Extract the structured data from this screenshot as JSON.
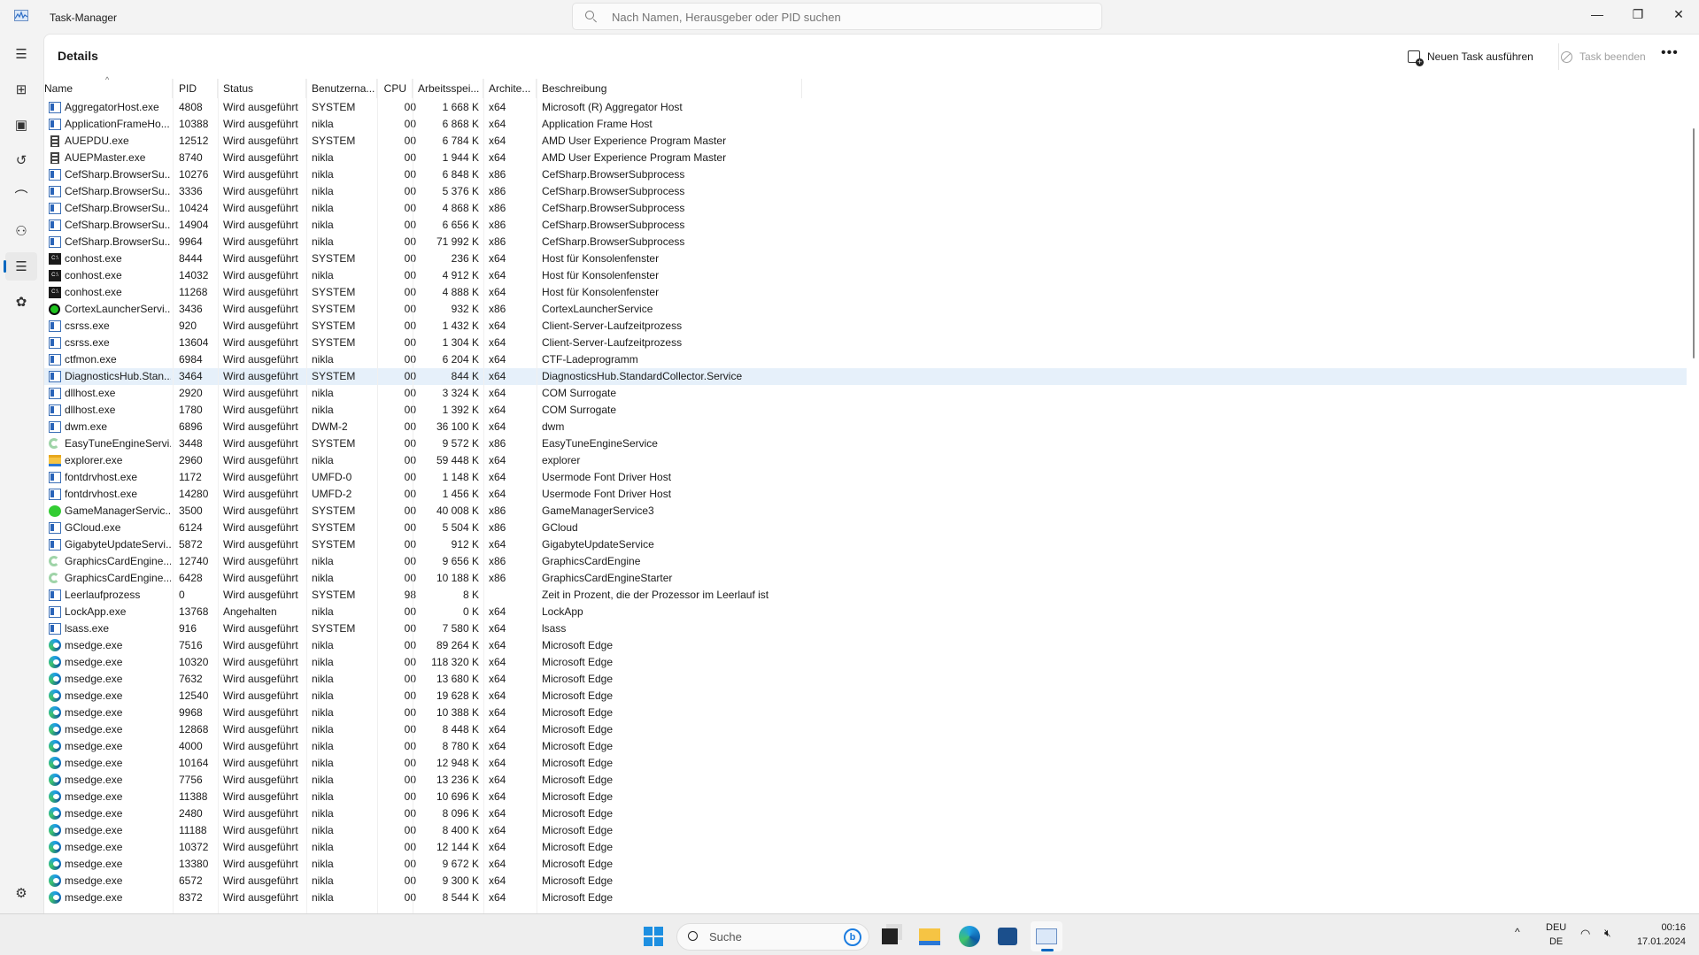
{
  "window": {
    "title": "Task-Manager",
    "search_placeholder": "Nach Namen, Herausgeber oder PID suchen"
  },
  "page": {
    "title": "Details",
    "new_task": "Neuen Task ausführen",
    "end_task": "Task beenden",
    "more": "•••"
  },
  "sidebar": [
    "menu-icon",
    "processes-icon",
    "performance-icon",
    "app-history-icon",
    "startup-apps-icon",
    "users-icon",
    "details-icon",
    "services-icon",
    "settings-icon"
  ],
  "columns": [
    "Name",
    "PID",
    "Status",
    "Benutzerna...",
    "CPU",
    "Arbeitsspei...",
    "Archite...",
    "Beschreibung"
  ],
  "selected_row": 16,
  "rows": [
    [
      "window",
      "AggregatorHost.exe",
      "4808",
      "Wird ausgeführt",
      "SYSTEM",
      "00",
      "1 668 K",
      "x64",
      "Microsoft (R) Aggregator Host"
    ],
    [
      "window",
      "ApplicationFrameHo...",
      "10388",
      "Wird ausgeführt",
      "nikla",
      "00",
      "6 868 K",
      "x64",
      "Application Frame Host"
    ],
    [
      "amd",
      "AUEPDU.exe",
      "12512",
      "Wird ausgeführt",
      "SYSTEM",
      "00",
      "6 784 K",
      "x64",
      "AMD User Experience Program Master"
    ],
    [
      "amd",
      "AUEPMaster.exe",
      "8740",
      "Wird ausgeführt",
      "nikla",
      "00",
      "1 944 K",
      "x64",
      "AMD User Experience Program Master"
    ],
    [
      "window",
      "CefSharp.BrowserSu...",
      "10276",
      "Wird ausgeführt",
      "nikla",
      "00",
      "6 848 K",
      "x86",
      "CefSharp.BrowserSubprocess"
    ],
    [
      "window",
      "CefSharp.BrowserSu...",
      "3336",
      "Wird ausgeführt",
      "nikla",
      "00",
      "5 376 K",
      "x86",
      "CefSharp.BrowserSubprocess"
    ],
    [
      "window",
      "CefSharp.BrowserSu...",
      "10424",
      "Wird ausgeführt",
      "nikla",
      "00",
      "4 868 K",
      "x86",
      "CefSharp.BrowserSubprocess"
    ],
    [
      "window",
      "CefSharp.BrowserSu...",
      "14904",
      "Wird ausgeführt",
      "nikla",
      "00",
      "6 656 K",
      "x86",
      "CefSharp.BrowserSubprocess"
    ],
    [
      "window",
      "CefSharp.BrowserSu...",
      "9964",
      "Wird ausgeführt",
      "nikla",
      "00",
      "71 992 K",
      "x86",
      "CefSharp.BrowserSubprocess"
    ],
    [
      "console",
      "conhost.exe",
      "8444",
      "Wird ausgeführt",
      "SYSTEM",
      "00",
      "236 K",
      "x64",
      "Host für Konsolenfenster"
    ],
    [
      "console",
      "conhost.exe",
      "14032",
      "Wird ausgeführt",
      "nikla",
      "00",
      "4 912 K",
      "x64",
      "Host für Konsolenfenster"
    ],
    [
      "console",
      "conhost.exe",
      "11268",
      "Wird ausgeführt",
      "SYSTEM",
      "00",
      "4 888 K",
      "x64",
      "Host für Konsolenfenster"
    ],
    [
      "cortex",
      "CortexLauncherServi...",
      "3436",
      "Wird ausgeführt",
      "SYSTEM",
      "00",
      "932 K",
      "x86",
      "CortexLauncherService"
    ],
    [
      "window",
      "csrss.exe",
      "920",
      "Wird ausgeführt",
      "SYSTEM",
      "00",
      "1 432 K",
      "x64",
      "Client-Server-Laufzeitprozess"
    ],
    [
      "window",
      "csrss.exe",
      "13604",
      "Wird ausgeführt",
      "SYSTEM",
      "00",
      "1 304 K",
      "x64",
      "Client-Server-Laufzeitprozess"
    ],
    [
      "window",
      "ctfmon.exe",
      "6984",
      "Wird ausgeführt",
      "nikla",
      "00",
      "6 204 K",
      "x64",
      "CTF-Ladeprogramm"
    ],
    [
      "window",
      "DiagnosticsHub.Stan...",
      "3464",
      "Wird ausgeführt",
      "SYSTEM",
      "00",
      "844 K",
      "x64",
      "DiagnosticsHub.StandardCollector.Service"
    ],
    [
      "window",
      "dllhost.exe",
      "2920",
      "Wird ausgeführt",
      "nikla",
      "00",
      "3 324 K",
      "x64",
      "COM Surrogate"
    ],
    [
      "window",
      "dllhost.exe",
      "1780",
      "Wird ausgeführt",
      "nikla",
      "00",
      "1 392 K",
      "x64",
      "COM Surrogate"
    ],
    [
      "window",
      "dwm.exe",
      "6896",
      "Wird ausgeführt",
      "DWM-2",
      "00",
      "36 100 K",
      "x64",
      "dwm"
    ],
    [
      "easytune",
      "EasyTuneEngineServi...",
      "3448",
      "Wird ausgeführt",
      "SYSTEM",
      "00",
      "9 572 K",
      "x86",
      "EasyTuneEngineService"
    ],
    [
      "folder",
      "explorer.exe",
      "2960",
      "Wird ausgeführt",
      "nikla",
      "00",
      "59 448 K",
      "x64",
      "explorer"
    ],
    [
      "window",
      "fontdrvhost.exe",
      "1172",
      "Wird ausgeführt",
      "UMFD-0",
      "00",
      "1 148 K",
      "x64",
      "Usermode Font Driver Host"
    ],
    [
      "window",
      "fontdrvhost.exe",
      "14280",
      "Wird ausgeführt",
      "UMFD-2",
      "00",
      "1 456 K",
      "x64",
      "Usermode Font Driver Host"
    ],
    [
      "razer",
      "GameManagerServic...",
      "3500",
      "Wird ausgeführt",
      "SYSTEM",
      "00",
      "40 008 K",
      "x86",
      "GameManagerService3"
    ],
    [
      "window",
      "GCloud.exe",
      "6124",
      "Wird ausgeführt",
      "SYSTEM",
      "00",
      "5 504 K",
      "x86",
      "GCloud"
    ],
    [
      "window",
      "GigabyteUpdateServi...",
      "5872",
      "Wird ausgeführt",
      "SYSTEM",
      "00",
      "912 K",
      "x64",
      "GigabyteUpdateService"
    ],
    [
      "easytune",
      "GraphicsCardEngine....",
      "12740",
      "Wird ausgeführt",
      "nikla",
      "00",
      "9 656 K",
      "x86",
      "GraphicsCardEngine"
    ],
    [
      "easytune",
      "GraphicsCardEngine...",
      "6428",
      "Wird ausgeführt",
      "nikla",
      "00",
      "10 188 K",
      "x86",
      "GraphicsCardEngineStarter"
    ],
    [
      "window",
      "Leerlaufprozess",
      "0",
      "Wird ausgeführt",
      "SYSTEM",
      "98",
      "8 K",
      "",
      "Zeit in Prozent, die der Prozessor im Leerlauf ist"
    ],
    [
      "window",
      "LockApp.exe",
      "13768",
      "Angehalten",
      "nikla",
      "00",
      "0 K",
      "x64",
      "LockApp"
    ],
    [
      "window",
      "lsass.exe",
      "916",
      "Wird ausgeführt",
      "SYSTEM",
      "00",
      "7 580 K",
      "x64",
      "lsass"
    ],
    [
      "edge",
      "msedge.exe",
      "7516",
      "Wird ausgeführt",
      "nikla",
      "00",
      "89 264 K",
      "x64",
      "Microsoft Edge"
    ],
    [
      "edge",
      "msedge.exe",
      "10320",
      "Wird ausgeführt",
      "nikla",
      "00",
      "118 320 K",
      "x64",
      "Microsoft Edge"
    ],
    [
      "edge",
      "msedge.exe",
      "7632",
      "Wird ausgeführt",
      "nikla",
      "00",
      "13 680 K",
      "x64",
      "Microsoft Edge"
    ],
    [
      "edge",
      "msedge.exe",
      "12540",
      "Wird ausgeführt",
      "nikla",
      "00",
      "19 628 K",
      "x64",
      "Microsoft Edge"
    ],
    [
      "edge",
      "msedge.exe",
      "9968",
      "Wird ausgeführt",
      "nikla",
      "00",
      "10 388 K",
      "x64",
      "Microsoft Edge"
    ],
    [
      "edge",
      "msedge.exe",
      "12868",
      "Wird ausgeführt",
      "nikla",
      "00",
      "8 448 K",
      "x64",
      "Microsoft Edge"
    ],
    [
      "edge",
      "msedge.exe",
      "4000",
      "Wird ausgeführt",
      "nikla",
      "00",
      "8 780 K",
      "x64",
      "Microsoft Edge"
    ],
    [
      "edge",
      "msedge.exe",
      "10164",
      "Wird ausgeführt",
      "nikla",
      "00",
      "12 948 K",
      "x64",
      "Microsoft Edge"
    ],
    [
      "edge",
      "msedge.exe",
      "7756",
      "Wird ausgeführt",
      "nikla",
      "00",
      "13 236 K",
      "x64",
      "Microsoft Edge"
    ],
    [
      "edge",
      "msedge.exe",
      "11388",
      "Wird ausgeführt",
      "nikla",
      "00",
      "10 696 K",
      "x64",
      "Microsoft Edge"
    ],
    [
      "edge",
      "msedge.exe",
      "2480",
      "Wird ausgeführt",
      "nikla",
      "00",
      "8 096 K",
      "x64",
      "Microsoft Edge"
    ],
    [
      "edge",
      "msedge.exe",
      "11188",
      "Wird ausgeführt",
      "nikla",
      "00",
      "8 400 K",
      "x64",
      "Microsoft Edge"
    ],
    [
      "edge",
      "msedge.exe",
      "10372",
      "Wird ausgeführt",
      "nikla",
      "00",
      "12 144 K",
      "x64",
      "Microsoft Edge"
    ],
    [
      "edge",
      "msedge.exe",
      "13380",
      "Wird ausgeführt",
      "nikla",
      "00",
      "9 672 K",
      "x64",
      "Microsoft Edge"
    ],
    [
      "edge",
      "msedge.exe",
      "6572",
      "Wird ausgeführt",
      "nikla",
      "00",
      "9 300 K",
      "x64",
      "Microsoft Edge"
    ],
    [
      "edge",
      "msedge.exe",
      "8372",
      "Wird ausgeführt",
      "nikla",
      "00",
      "8 544 K",
      "x64",
      "Microsoft Edge"
    ]
  ],
  "taskbar": {
    "search_label": "Suche",
    "lang_top": "DEU",
    "lang_bottom": "DE",
    "time": "00:16",
    "date": "17.01.2024"
  },
  "colors": {
    "accent": "#0067c0",
    "selection": "#e6f0fa"
  }
}
